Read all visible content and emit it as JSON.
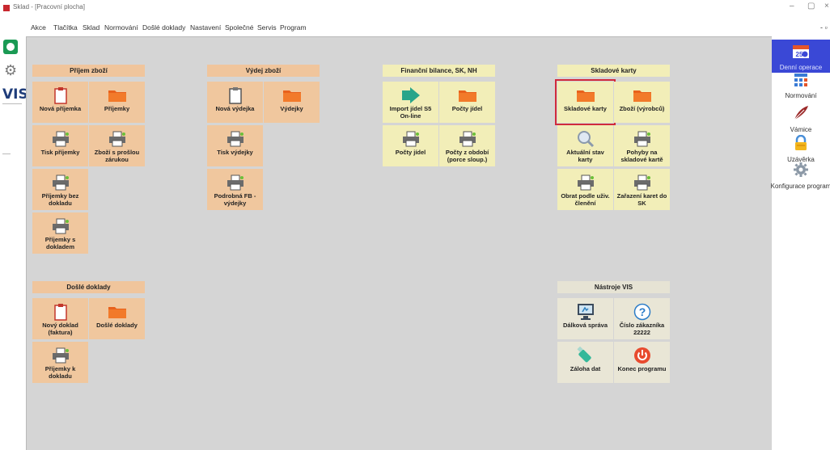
{
  "window": {
    "title": "Sklad - [Pracovní plocha]"
  },
  "menu": [
    "Akce",
    "Tlačítka",
    "Sklad",
    "Normování",
    "Došlé doklady",
    "Nastavení",
    "Společné",
    "Servis",
    "Program"
  ],
  "leftbar": {
    "vis_label": "VIS"
  },
  "groups": {
    "prijem": {
      "header": "Příjem zboží",
      "tiles": [
        "Nová příjemka",
        "Příjemky",
        "Tisk příjemky",
        "Zboží s prošlou zárukou",
        "Příjemky bez dokladu",
        "Příjemky s dokladem"
      ]
    },
    "vydej": {
      "header": "Výdej zboží",
      "tiles": [
        "Nová výdejka",
        "Výdejky",
        "Tisk výdejky",
        "Podrobná FB - výdejky"
      ]
    },
    "financni": {
      "header": "Finanční bilance, SK, NH",
      "tiles": [
        "Import jídel S5 On-line",
        "Počty jídel",
        "Počty jídel",
        "Počty z období (porce sloup.)"
      ]
    },
    "skladove": {
      "header": "Skladové karty",
      "tiles": [
        "Skladové karty",
        "Zboží (výrobců)",
        "Aktuální stav karty",
        "Pohyby na skladové kartě",
        "Obrat podle uživ. členění",
        "Zařazení karet do SK"
      ]
    },
    "dosle": {
      "header": "Došlé doklady",
      "tiles": [
        "Nový doklad (faktura)",
        "Došlé doklady",
        "Příjemky k dokladu"
      ]
    },
    "nastroje": {
      "header": "Nástroje VIS",
      "tiles": [
        "Dálková správa",
        "Číslo zákazníka 22222",
        "Záloha dat",
        "Konec programu"
      ]
    }
  },
  "rightbar": {
    "items": [
      "Denní operace",
      "Normování",
      "Vámice",
      "Uzávěrka",
      "Konfigurace program"
    ],
    "calendar_number": "25"
  },
  "colors": {
    "accent": "#3a48d6",
    "tile_orange": "#f0c79e",
    "tile_yellow": "#f2eeb8",
    "selection": "#d12b3c"
  }
}
